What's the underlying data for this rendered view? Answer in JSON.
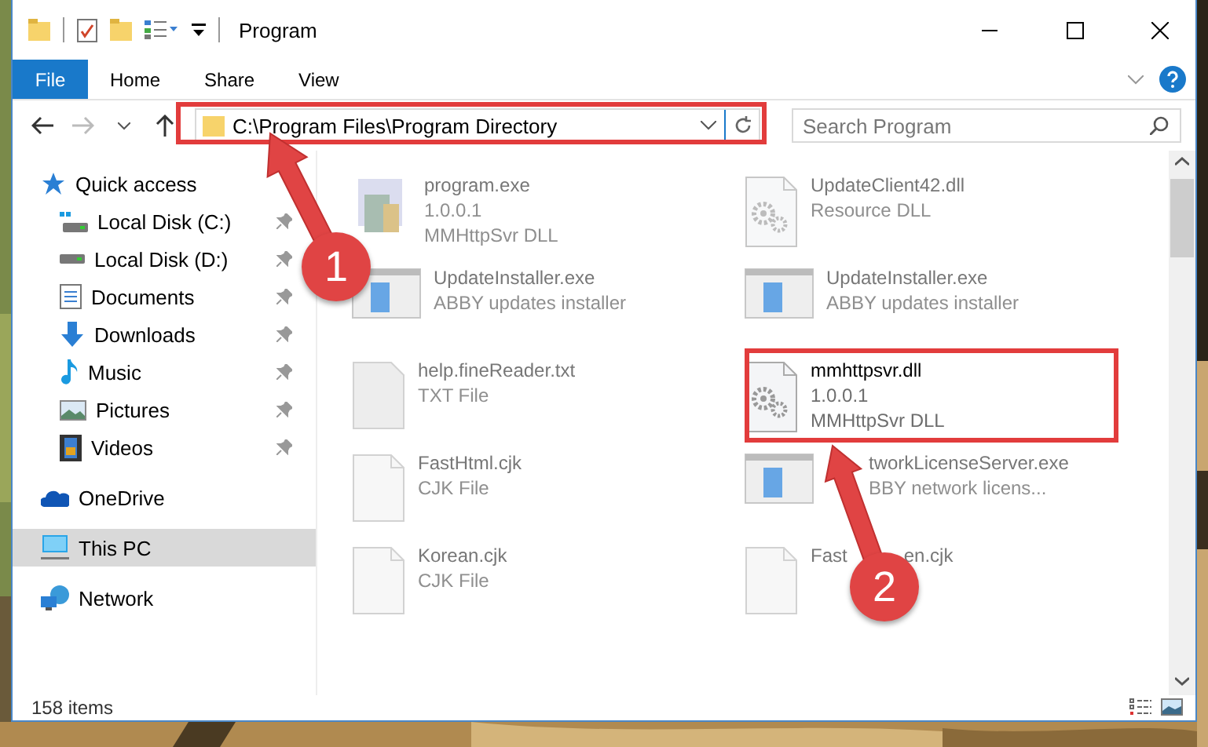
{
  "window": {
    "title": "Program"
  },
  "ribbon_tabs": [
    {
      "label": "File",
      "kind": "file"
    },
    {
      "label": "Home",
      "kind": "tab"
    },
    {
      "label": "Share",
      "kind": "tab"
    },
    {
      "label": "View",
      "kind": "tab"
    }
  ],
  "address": {
    "path": "C:\\Program Files\\Program Directory"
  },
  "search": {
    "placeholder": "Search Program"
  },
  "nav": [
    {
      "label": "Quick access",
      "kind": "star",
      "selected": false,
      "children": [
        {
          "label": "Local Disk (C:)",
          "kind": "system-drive",
          "pinned": true
        },
        {
          "label": "Local Disk (D:)",
          "kind": "drive",
          "pinned": true
        },
        {
          "label": "Documents",
          "kind": "documents",
          "pinned": true
        },
        {
          "label": "Downloads",
          "kind": "downloads",
          "pinned": true
        },
        {
          "label": "Music",
          "kind": "music",
          "pinned": true
        },
        {
          "label": "Pictures",
          "kind": "pictures",
          "pinned": true
        },
        {
          "label": "Videos",
          "kind": "videos",
          "pinned": true
        }
      ]
    },
    {
      "label": "OneDrive",
      "kind": "cloud",
      "selected": false
    },
    {
      "label": "This PC",
      "kind": "pc",
      "selected": true
    },
    {
      "label": "Network",
      "kind": "network",
      "selected": false
    }
  ],
  "files": [
    {
      "name": "program.exe",
      "lines": [
        "1.0.0.1",
        "MMHttpSvr DLL"
      ],
      "kind": "app",
      "blurred": true
    },
    {
      "name": "UpdateClient42.dll",
      "lines": [
        "Resource DLL"
      ],
      "kind": "dll",
      "blurred": true
    },
    {
      "name": "UpdateInstaller.exe",
      "lines": [
        "ABBY updates installer"
      ],
      "kind": "window",
      "blurred": true
    },
    {
      "name": "UpdateInstaller.exe",
      "lines": [
        "ABBY updates installer"
      ],
      "kind": "window",
      "blurred": true
    },
    {
      "name": "help.fineReader.txt",
      "lines": [
        "TXT File"
      ],
      "kind": "text",
      "blurred": true
    },
    {
      "name": "mmhttpsvr.dll",
      "lines": [
        "1.0.0.1",
        "MMHttpSvr DLL"
      ],
      "kind": "dll",
      "blurred": false
    },
    {
      "name": "FastHtml.cjk",
      "lines": [
        "CJK File"
      ],
      "kind": "blank",
      "blurred": true
    },
    {
      "name": "tworkLicenseServer.exe",
      "lines": [
        "BBY network licens..."
      ],
      "kind": "window",
      "blurred": true
    },
    {
      "name": "Korean.cjk",
      "lines": [
        "CJK File"
      ],
      "kind": "blank",
      "blurred": true
    },
    {
      "name": "Fast",
      "name_tail": "en.cjk",
      "kind": "blank",
      "blurred": true
    }
  ],
  "status_bar": {
    "count": "158 items"
  },
  "annotations": [
    {
      "number": "1"
    },
    {
      "number": "2"
    }
  ]
}
